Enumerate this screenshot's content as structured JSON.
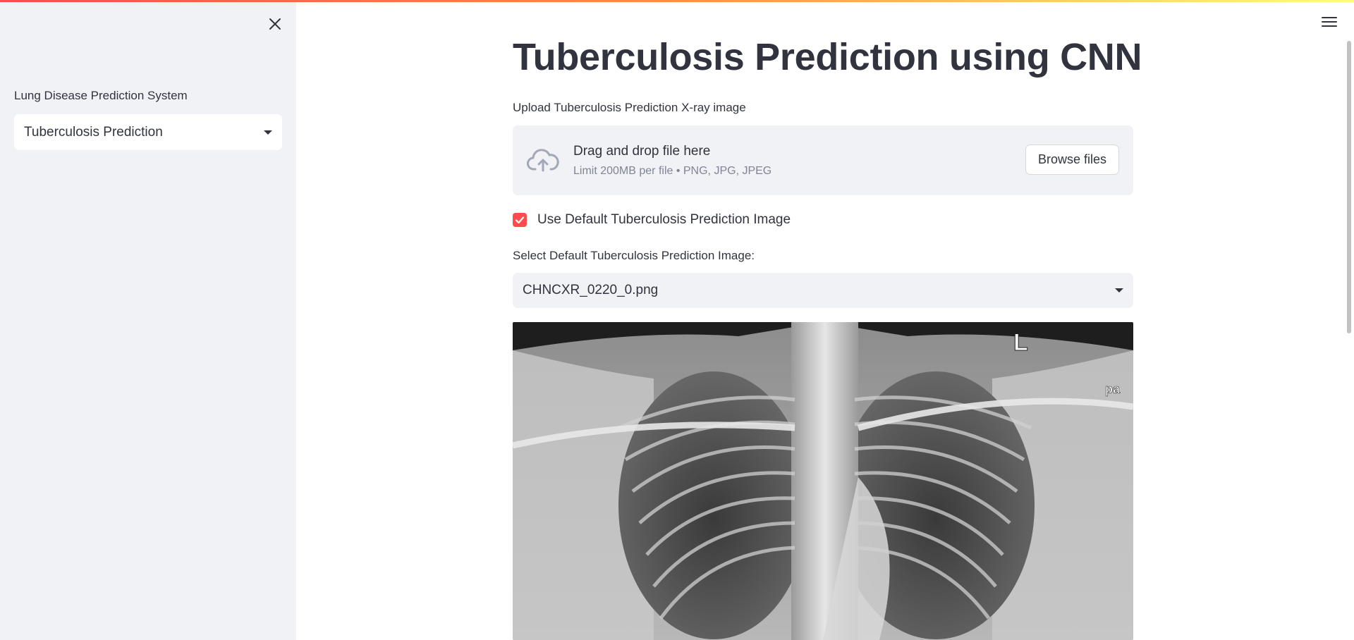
{
  "sidebar": {
    "label": "Lung Disease Prediction System",
    "selected": "Tuberculosis Prediction"
  },
  "main": {
    "title": "Tuberculosis Prediction using CNN",
    "upload_label": "Upload Tuberculosis Prediction X-ray image",
    "dropzone": {
      "title": "Drag and drop file here",
      "limit": "Limit 200MB per file • PNG, JPG, JPEG",
      "button": "Browse files"
    },
    "checkbox": {
      "label": "Use Default Tuberculosis Prediction Image",
      "checked": true
    },
    "select_label": "Select Default Tuberculosis Prediction Image:",
    "select_value": "CHNCXR_0220_0.png",
    "image": {
      "marker_l": "L",
      "marker_pa": "pa"
    }
  },
  "icons": [
    "close-icon",
    "chevron-down-icon",
    "menu-icon",
    "upload-cloud-icon",
    "check-icon"
  ],
  "colors": {
    "accent": "#ff4b4b",
    "sidebar_bg": "#f0f2f6",
    "text": "#31333f",
    "muted_text": "#808495"
  }
}
